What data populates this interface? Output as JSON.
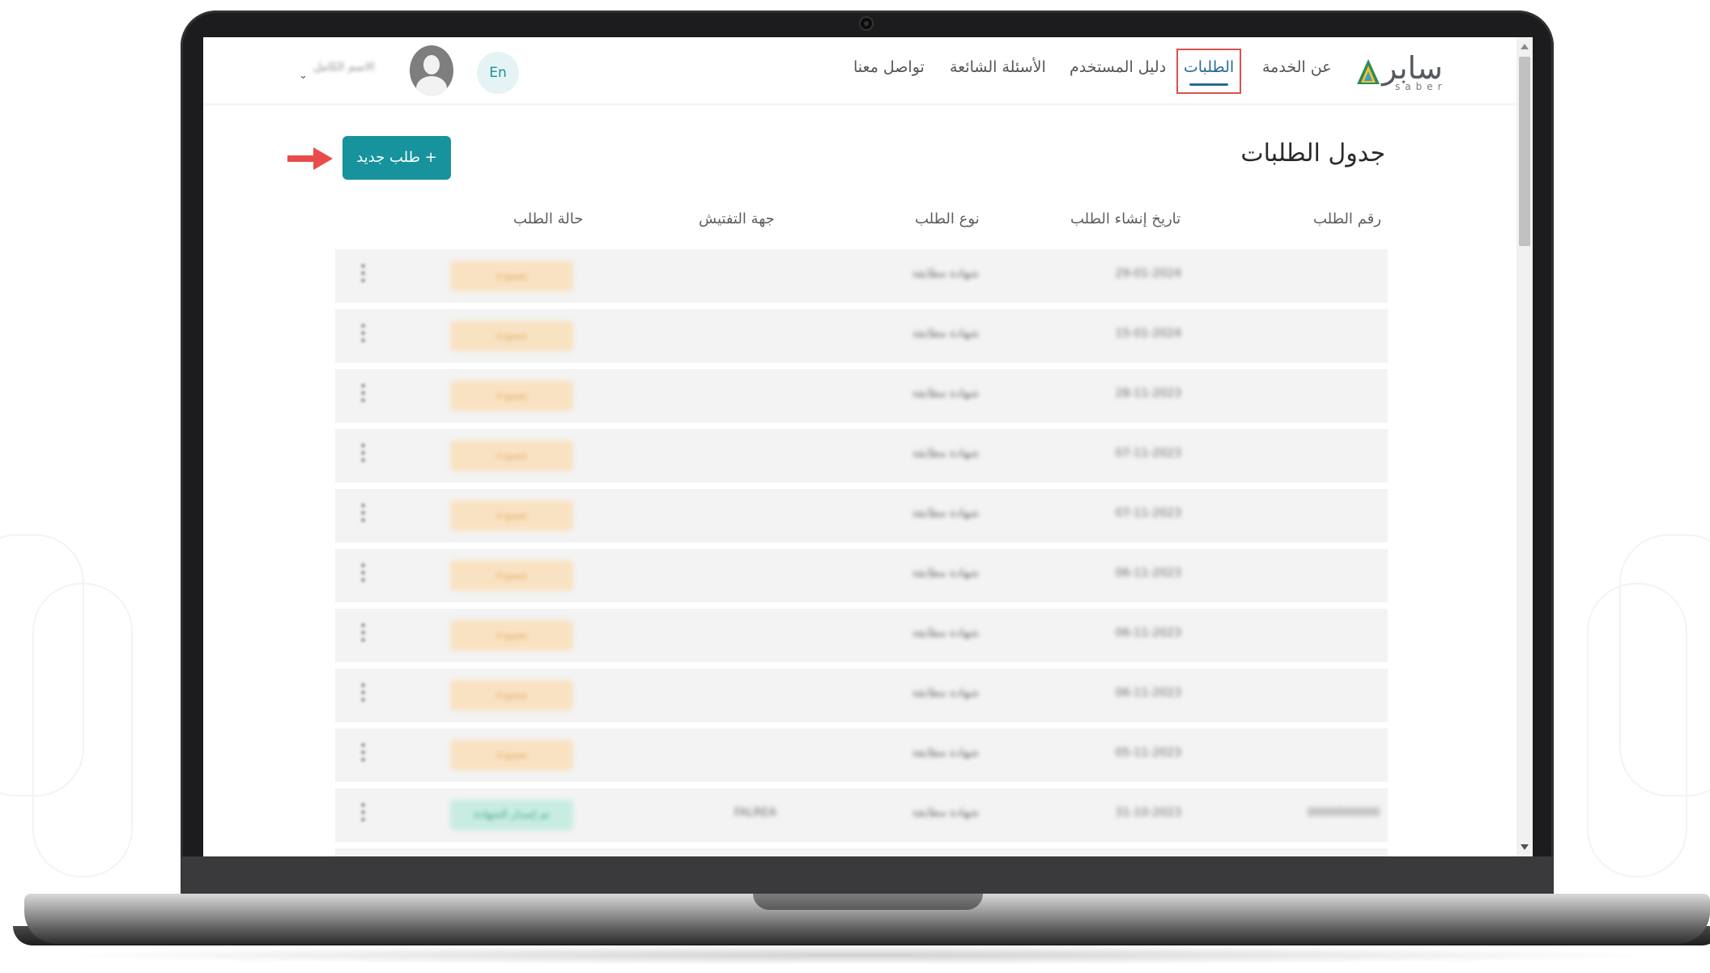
{
  "header": {
    "logo": {
      "text": "سابر",
      "sub": "saber"
    },
    "nav": [
      {
        "label": "عن الخدمة",
        "active": false
      },
      {
        "label": "الطلبات",
        "active": true
      },
      {
        "label": "دليل المستخدم",
        "active": false
      },
      {
        "label": "الأسئلة الشائعة",
        "active": false
      },
      {
        "label": "تواصل معنا",
        "active": false
      }
    ],
    "lang_label": "En",
    "user_name": "الاسم الكامل"
  },
  "page": {
    "title": "جدول الطلبات",
    "new_button_label": "+  طلب جديد"
  },
  "table": {
    "columns": [
      "رقم الطلب",
      "تاريخ إنشاء الطلب",
      "نوع الطلب",
      "جهة التفتيش",
      "حالة الطلب"
    ],
    "rows": [
      {
        "number": "",
        "date": "29-01-2024",
        "type": "شهادة مطابقة",
        "inspection": "",
        "status": "مسودة",
        "status_color": "orange"
      },
      {
        "number": "",
        "date": "15-01-2024",
        "type": "شهادة مطابقة",
        "inspection": "",
        "status": "مسودة",
        "status_color": "orange"
      },
      {
        "number": "",
        "date": "28-11-2023",
        "type": "شهادة مطابقة",
        "inspection": "",
        "status": "مسودة",
        "status_color": "orange"
      },
      {
        "number": "",
        "date": "07-11-2023",
        "type": "شهادة مطابقة",
        "inspection": "",
        "status": "مسودة",
        "status_color": "orange"
      },
      {
        "number": "",
        "date": "07-11-2023",
        "type": "شهادة مطابقة",
        "inspection": "",
        "status": "مسودة",
        "status_color": "orange"
      },
      {
        "number": "",
        "date": "06-11-2023",
        "type": "شهادة مطابقة",
        "inspection": "",
        "status": "مسودة",
        "status_color": "orange"
      },
      {
        "number": "",
        "date": "06-11-2023",
        "type": "شهادة مطابقة",
        "inspection": "",
        "status": "مسودة",
        "status_color": "orange"
      },
      {
        "number": "",
        "date": "06-11-2023",
        "type": "شهادة مطابقة",
        "inspection": "",
        "status": "مسودة",
        "status_color": "orange"
      },
      {
        "number": "",
        "date": "05-11-2023",
        "type": "شهادة مطابقة",
        "inspection": "",
        "status": "مسودة",
        "status_color": "orange"
      },
      {
        "number": "0000000000",
        "date": "31-10-2023",
        "type": "شهادة مطابقة",
        "inspection": "FALREA",
        "status": "تم إصدار الشهادة",
        "status_color": "green"
      }
    ]
  },
  "colors": {
    "primary": "#16939d",
    "nav_active": "#2a6a95",
    "highlight_box": "#d9534f",
    "status_draft_bg": "#f9e2c2",
    "status_done_bg": "#c8ece1"
  },
  "icons": [
    "logo-mark-icon",
    "user-avatar-icon",
    "chevron-down-icon",
    "red-arrow-icon",
    "kebab-menu-icon",
    "scroll-up-icon",
    "scroll-down-icon"
  ]
}
